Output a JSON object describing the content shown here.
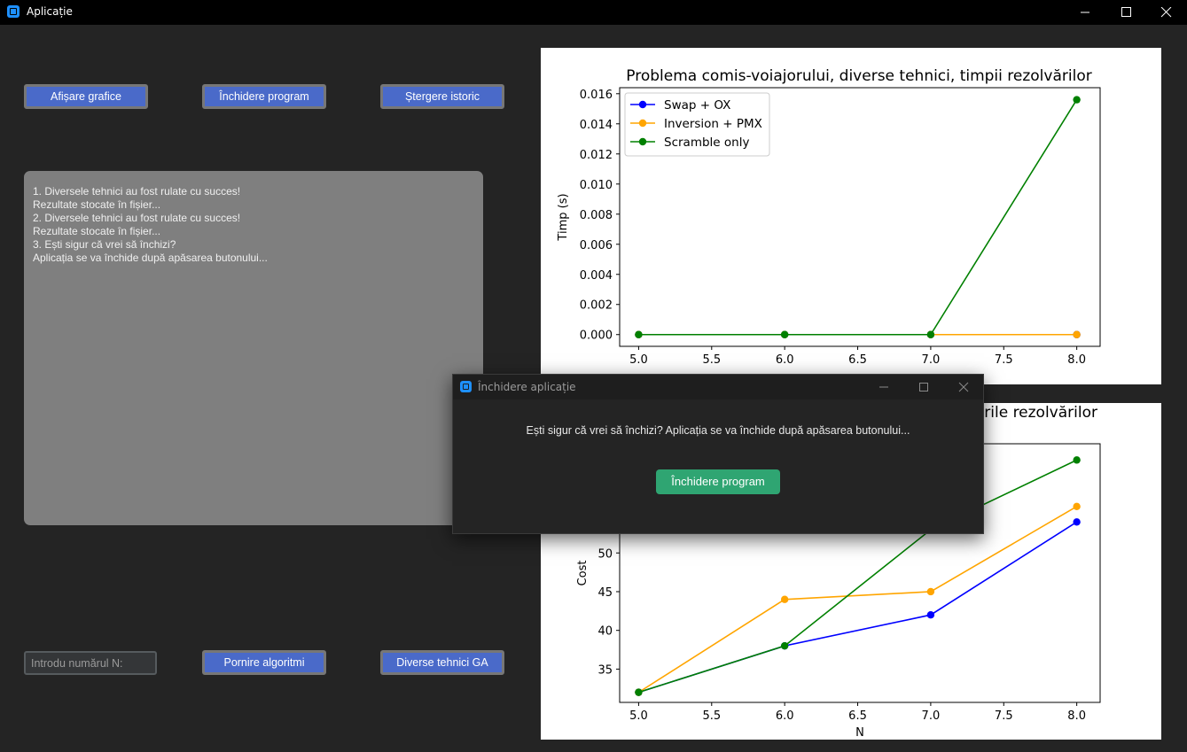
{
  "window": {
    "title": "Aplicație"
  },
  "toolbar": {
    "show_charts": "Afișare grafice",
    "close_program": "Închidere program",
    "clear_history": "Ștergere istoric"
  },
  "log": {
    "lines": [
      "1. Diversele tehnici au fost rulate cu succes!",
      "Rezultate stocate în fișier...",
      "2. Diversele tehnici au fost rulate cu succes!",
      "Rezultate stocate în fișier...",
      "3. Ești sigur că vrei să închizi?",
      "Aplicația se va închide după apăsarea butonului..."
    ]
  },
  "bottom": {
    "n_placeholder": "Introdu numărul N:",
    "start_algorithms": "Pornire algoritmi",
    "ga_techniques": "Diverse tehnici GA"
  },
  "dialog": {
    "title": "Închidere aplicație",
    "message": "Ești sigur că vrei să închizi? Aplicația se va închide după apăsarea butonului...",
    "button": "Închidere program"
  },
  "chart_data": [
    {
      "type": "line",
      "title": "Problema comis-voiajorului, diverse tehnici, timpii rezolvărilor",
      "xlabel": "",
      "ylabel": "Timp (s)",
      "x": [
        5,
        6,
        7,
        8
      ],
      "xticks": [
        "5.0",
        "5.5",
        "6.0",
        "6.5",
        "7.0",
        "7.5",
        "8.0"
      ],
      "yticks": [
        "0.000",
        "0.002",
        "0.004",
        "0.006",
        "0.008",
        "0.010",
        "0.012",
        "0.014",
        "0.016"
      ],
      "xlim": [
        4.87,
        8.16
      ],
      "ylim": [
        -0.00078,
        0.0164
      ],
      "legend": "upper-left",
      "series": [
        {
          "name": "Swap + OX",
          "color": "#0000ff",
          "values": [
            0,
            0,
            0,
            0
          ]
        },
        {
          "name": "Inversion + PMX",
          "color": "#ffa500",
          "values": [
            0,
            0,
            0,
            0
          ]
        },
        {
          "name": "Scramble only",
          "color": "#008000",
          "values": [
            0,
            0,
            0,
            0.0156
          ]
        }
      ]
    },
    {
      "type": "line",
      "title": "rile rezolvărilor",
      "xlabel": "N",
      "ylabel": "Cost",
      "x": [
        5,
        6,
        7,
        8
      ],
      "xticks": [
        "5.0",
        "5.5",
        "6.0",
        "6.5",
        "7.0",
        "7.5",
        "8.0"
      ],
      "yticks": [
        "35",
        "40",
        "45",
        "50"
      ],
      "xlim": [
        4.87,
        8.16
      ],
      "ylim": [
        30.7,
        64.1
      ],
      "series": [
        {
          "name": "Swap + OX",
          "color": "#0000ff",
          "values": [
            32,
            38,
            42,
            54
          ]
        },
        {
          "name": "Inversion + PMX",
          "color": "#ffa500",
          "values": [
            32,
            44,
            45,
            56
          ]
        },
        {
          "name": "Scramble only",
          "color": "#008000",
          "values": [
            32,
            38,
            53,
            62
          ]
        }
      ]
    }
  ]
}
